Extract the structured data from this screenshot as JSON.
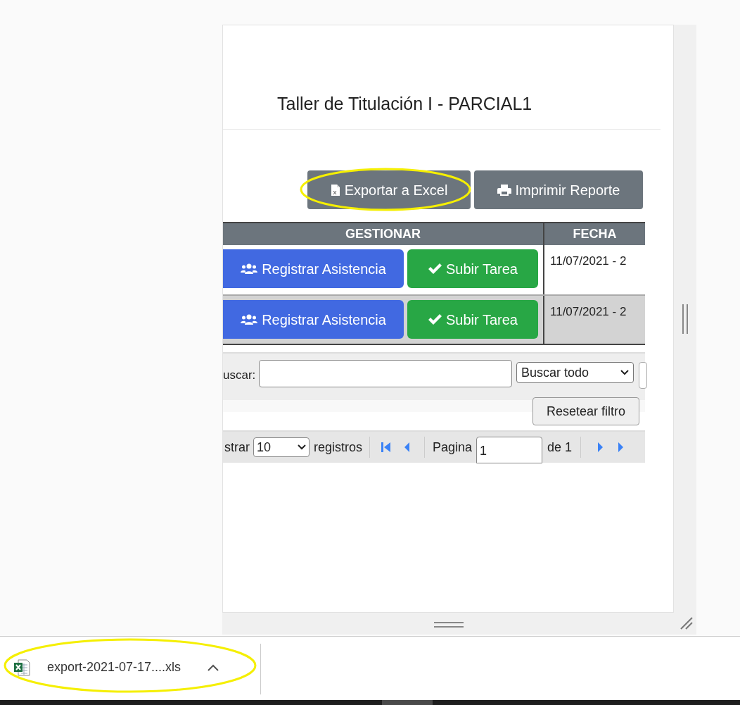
{
  "title": "Taller de Titulación I - PARCIAL1",
  "actions": [
    {
      "label": "Exportar a Excel",
      "kind": "excel"
    },
    {
      "label": "Imprimir Reporte",
      "kind": "print"
    }
  ],
  "table": {
    "columns": [
      "GESTIONAR",
      "FECHA"
    ],
    "rows": [
      {
        "buttons": [
          {
            "label": "Registrar Asistencia",
            "kind": "attendance"
          },
          {
            "label": "Subir Tarea",
            "kind": "upload"
          }
        ],
        "fecha": "11/07/2021 - 2"
      },
      {
        "buttons": [
          {
            "label": "Registrar Asistencia",
            "kind": "attendance"
          },
          {
            "label": "Subir Tarea",
            "kind": "upload"
          }
        ],
        "fecha": "11/07/2021 - 2"
      }
    ]
  },
  "filter": {
    "search_label": "uscar:",
    "scope": "Buscar todo",
    "reset": "Resetear filtro"
  },
  "pager": {
    "show_label": "strar",
    "page_size": "10",
    "records_label": "registros",
    "page_label": "Pagina",
    "page": "1",
    "of_label": "de 1"
  },
  "download": {
    "filename": "export-2021-07-17....xls"
  }
}
